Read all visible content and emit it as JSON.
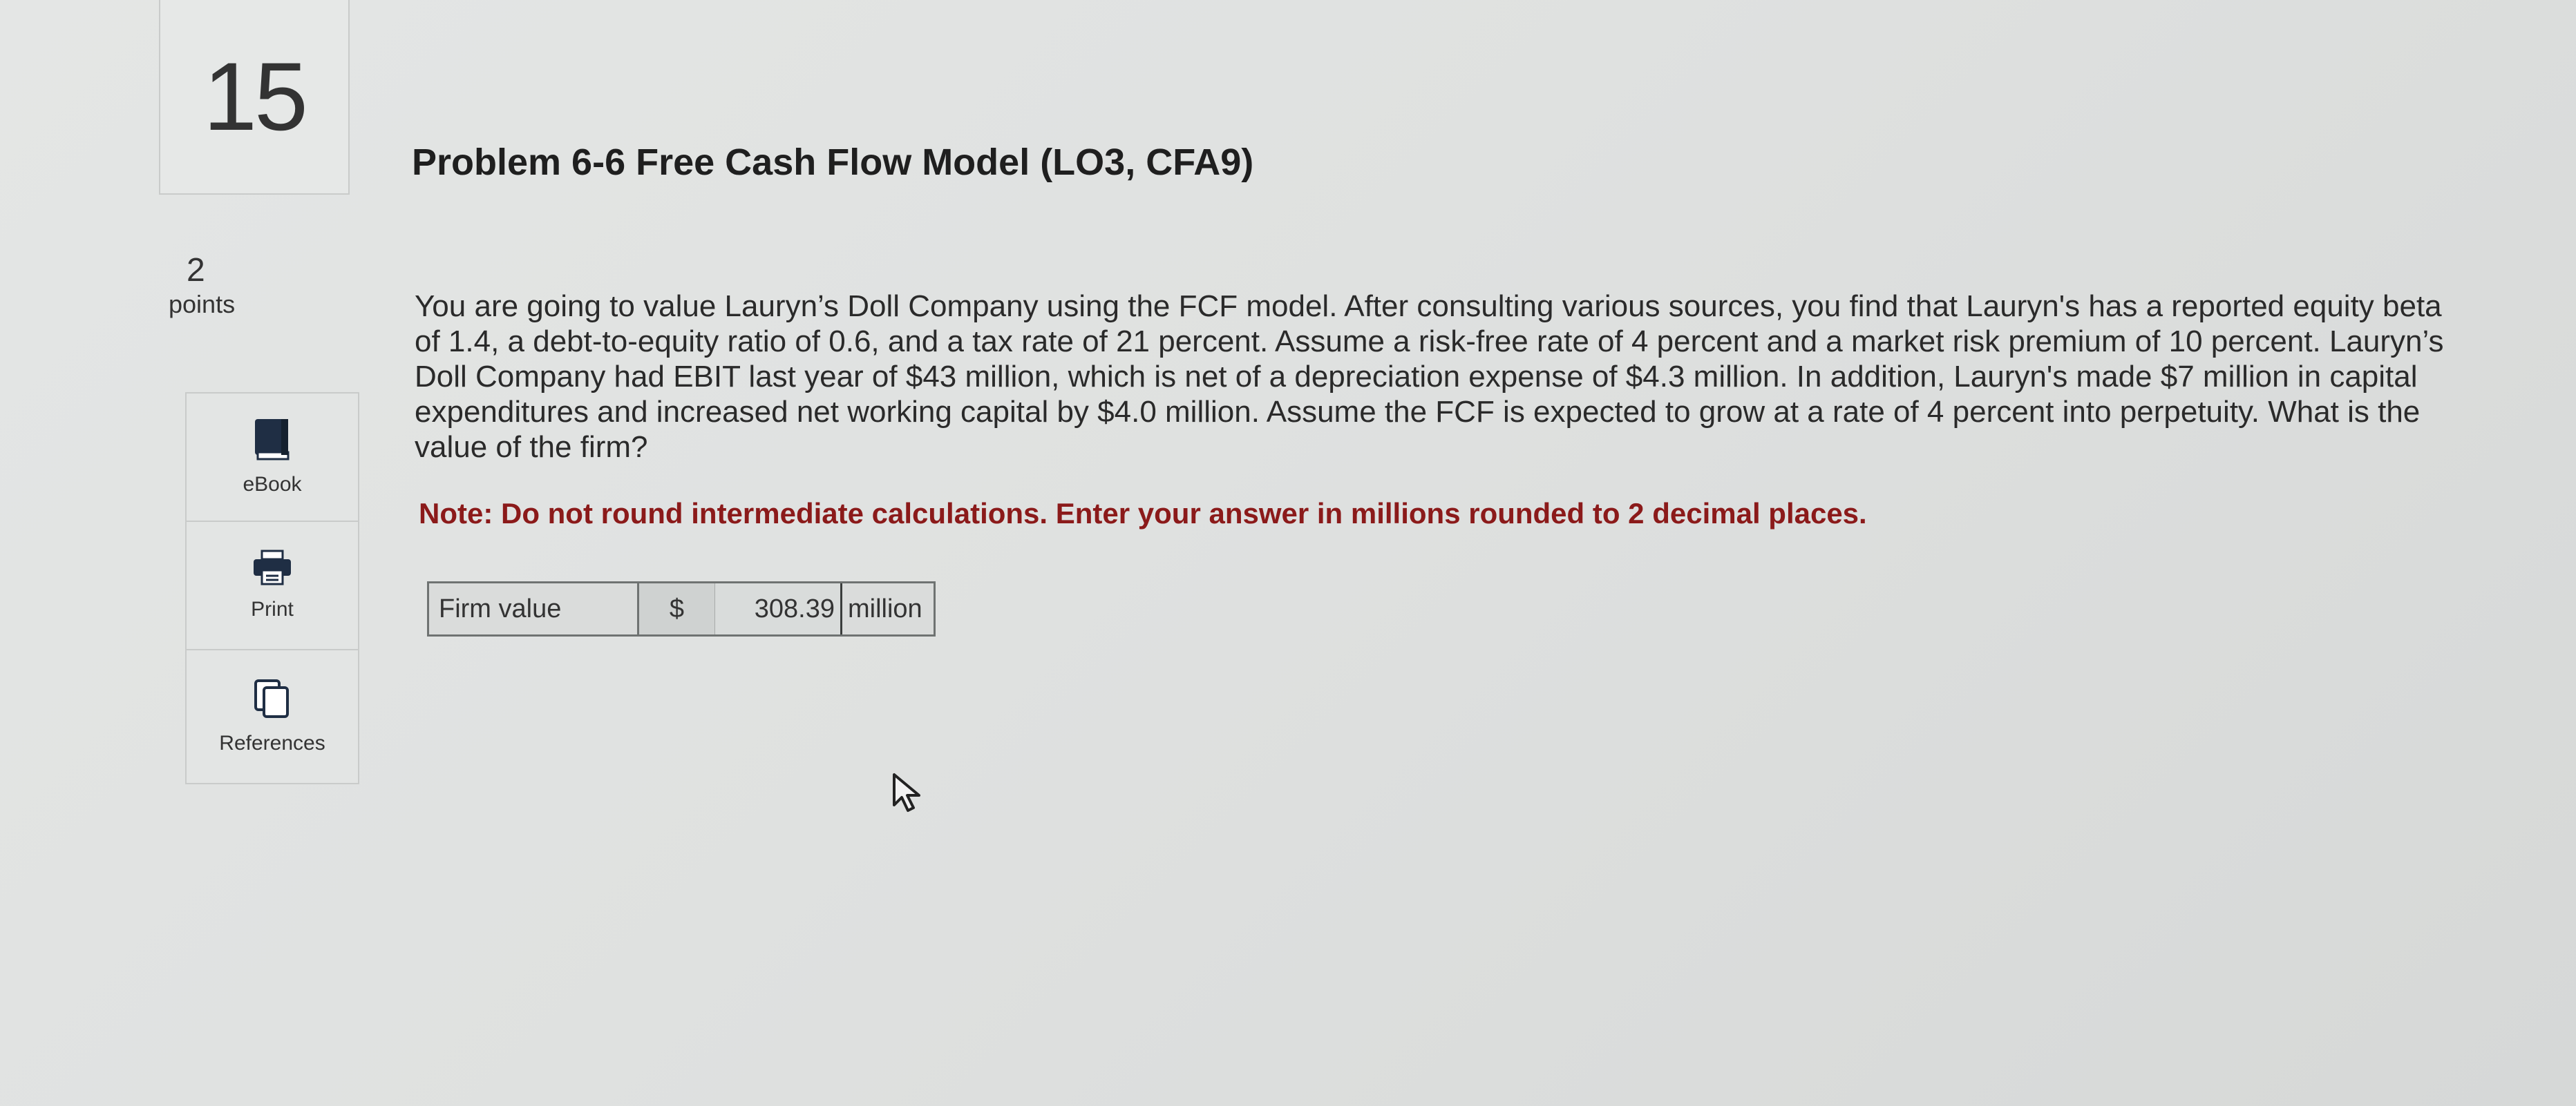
{
  "question_number": "15",
  "points": {
    "value": "2",
    "label": "points"
  },
  "tools": [
    {
      "label": "eBook",
      "icon": "ebook-icon"
    },
    {
      "label": "Print",
      "icon": "print-icon"
    },
    {
      "label": "References",
      "icon": "references-icon"
    }
  ],
  "problem": {
    "title": "Problem 6-6 Free Cash Flow Model (LO3, CFA9)",
    "text": "You are going to value Lauryn’s Doll Company using the FCF model. After consulting various sources, you find that Lauryn's has a reported equity beta of 1.4, a debt-to-equity ratio of 0.6, and a tax rate of 21 percent. Assume a risk-free rate of 4 percent and a market risk premium of 10 percent. Lauryn’s Doll Company had EBIT last year of $43 million, which is net of a depreciation expense of $4.3 million. In addition, Lauryn's made $7 million in capital expenditures and increased net working capital by $4.0 million. Assume the FCF is expected to grow at a rate of 4 percent into perpetuity. What is the value of the firm?",
    "note": "Note: Do not round intermediate calculations. Enter your answer in millions rounded to 2 decimal places."
  },
  "answer": {
    "label": "Firm value",
    "currency": "$",
    "value": "308.39",
    "unit": "million"
  },
  "colors": {
    "note": "#8b1a1a",
    "background": "#e1e3e2"
  }
}
